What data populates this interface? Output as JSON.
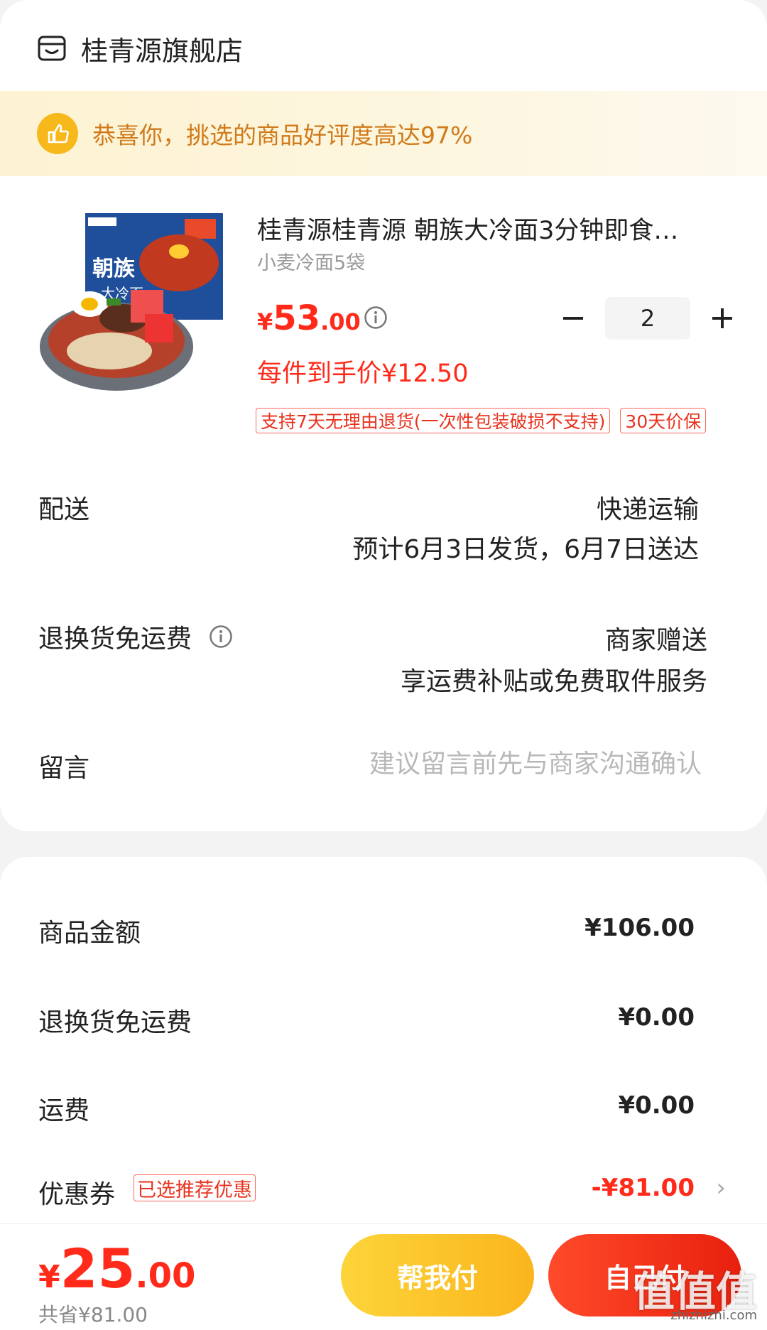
{
  "store": {
    "name": "桂青源旗舰店"
  },
  "banner": {
    "text": "恭喜你，挑选的商品好评度高达97%"
  },
  "product": {
    "title": "桂青源桂青源 朝族大冷面3分钟即食…",
    "spec": "小麦冷面5袋",
    "price_currency": "¥",
    "price_int": "53",
    "price_dec": ".00",
    "quantity": "2",
    "unit_price": "每件到手价¥12.50",
    "tags": [
      "支持7天无理由退货(一次性包装破损不支持)",
      "30天价保"
    ]
  },
  "delivery": {
    "label": "配送",
    "method": "快递运输",
    "estimate": "预计6月3日发货，6月7日送达"
  },
  "return_shipping": {
    "label": "退换货免运费",
    "value": "商家赠送",
    "desc": "享运费补贴或免费取件服务"
  },
  "message": {
    "label": "留言",
    "placeholder": "建议留言前先与商家沟通确认"
  },
  "summary": {
    "goods_label": "商品金额",
    "goods_value": "¥106.00",
    "return_label": "退换货免运费",
    "return_value": "¥0.00",
    "shipping_label": "运费",
    "shipping_value": "¥0.00",
    "coupon_label": "优惠券",
    "coupon_badge": "已选推荐优惠",
    "coupon_value": "-¥81.00",
    "chevron": "›"
  },
  "bottom": {
    "total_currency": "¥",
    "total_int": "25",
    "total_dec": ".00",
    "saved": "共省¥81.00",
    "help_pay": "帮我付",
    "self_pay": "自己付",
    "watermark": "值值值",
    "watermark_sub": "zhizhizhi.com"
  },
  "colors": {
    "accent": "#ff2a1a",
    "banner_text": "#d07a1a",
    "yellow_btn": "#fbc12a"
  }
}
